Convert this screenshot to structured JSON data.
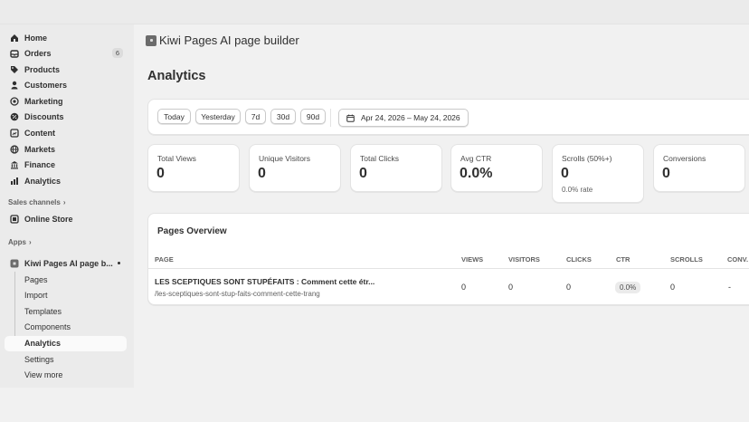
{
  "sidebar": {
    "items": [
      {
        "label": "Home",
        "icon": "home-icon"
      },
      {
        "label": "Orders",
        "icon": "orders-icon",
        "count": "6"
      },
      {
        "label": "Products",
        "icon": "tag-icon"
      },
      {
        "label": "Customers",
        "icon": "person-icon"
      },
      {
        "label": "Marketing",
        "icon": "target-icon"
      },
      {
        "label": "Discounts",
        "icon": "discount-icon"
      },
      {
        "label": "Content",
        "icon": "content-icon"
      },
      {
        "label": "Markets",
        "icon": "globe-icon"
      },
      {
        "label": "Finance",
        "icon": "bank-icon"
      },
      {
        "label": "Analytics",
        "icon": "chart-icon"
      }
    ],
    "sales_channels_label": "Sales channels",
    "online_store_label": "Online Store",
    "apps_label": "Apps",
    "app_name": "Kiwi Pages AI page b...",
    "app_sub_items": [
      "Pages",
      "Import",
      "Templates",
      "Components",
      "Analytics",
      "Settings",
      "View more"
    ]
  },
  "header": {
    "app_title": "Kiwi Pages AI page builder",
    "page_title": "Analytics"
  },
  "filters": {
    "ranges": [
      "Today",
      "Yesterday",
      "7d",
      "30d",
      "90d"
    ],
    "date_range": "Apr 24, 2026 – May 24, 2026"
  },
  "stats": [
    {
      "label": "Total Views",
      "value": "0"
    },
    {
      "label": "Unique Visitors",
      "value": "0"
    },
    {
      "label": "Total Clicks",
      "value": "0"
    },
    {
      "label": "Avg CTR",
      "value": "0.0%"
    },
    {
      "label": "Scrolls (50%+)",
      "value": "0",
      "sub": "0.0% rate"
    },
    {
      "label": "Conversions",
      "value": "0"
    }
  ],
  "pages_overview": {
    "title": "Pages Overview",
    "columns": [
      "PAGE",
      "VIEWS",
      "VISITORS",
      "CLICKS",
      "CTR",
      "SCROLLS",
      "CONV."
    ],
    "rows": [
      {
        "title": "LES SCEPTIQUES SONT STUPÉFAITS : Comment cette étr...",
        "slug": "/les-sceptiques-sont-stup-faits-comment-cette-trang",
        "views": "0",
        "visitors": "0",
        "clicks": "0",
        "ctr": "0.0%",
        "scrolls": "0",
        "conv": "-"
      }
    ]
  }
}
